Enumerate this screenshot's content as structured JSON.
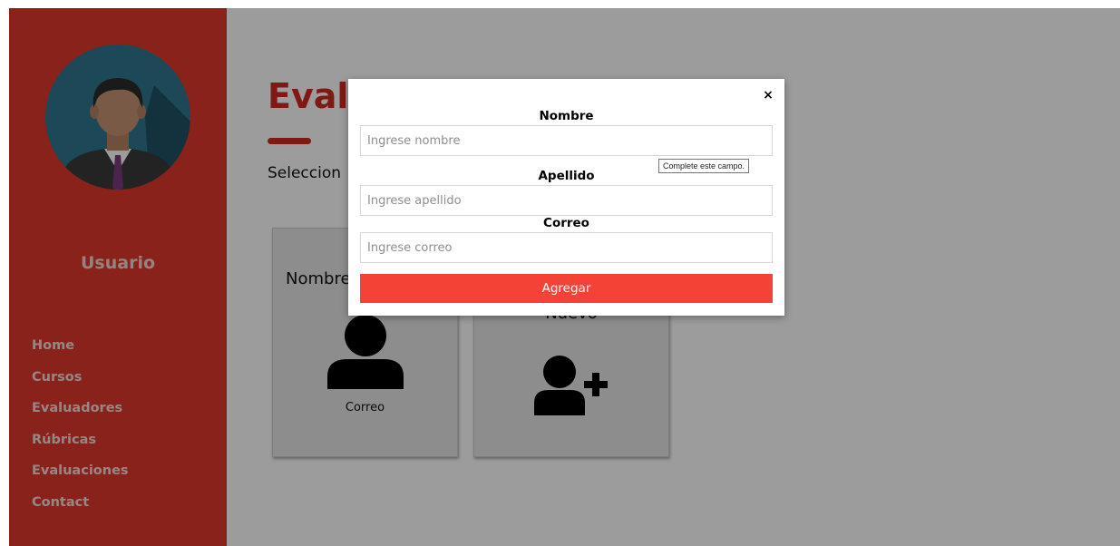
{
  "sidebar": {
    "user_name": "Usuario",
    "nav_items": [
      {
        "label": "Home",
        "name": "nav-home"
      },
      {
        "label": "Cursos",
        "name": "nav-cursos"
      },
      {
        "label": "Evaluadores",
        "name": "nav-evaluadores"
      },
      {
        "label": "Rúbricas",
        "name": "nav-rubricas"
      },
      {
        "label": "Evaluaciones",
        "name": "nav-evaluaciones"
      },
      {
        "label": "Contact",
        "name": "nav-contact"
      }
    ]
  },
  "main": {
    "title": "Evalu",
    "subtitle": "Seleccion",
    "cards": {
      "evaluator": {
        "name": "Nombre",
        "email": "Correo",
        "icon": "user-icon"
      },
      "new": {
        "title": "Nuevo",
        "icon": "user-plus-icon"
      }
    }
  },
  "modal": {
    "close_label": "×",
    "fields": {
      "nombre": {
        "label": "Nombre",
        "placeholder": "Ingrese nombre",
        "value": ""
      },
      "apellido": {
        "label": "Apellido",
        "placeholder": "Ingrese apellido",
        "value": ""
      },
      "correo": {
        "label": "Correo",
        "placeholder": "Ingrese correo",
        "value": ""
      }
    },
    "submit_label": "Agregar",
    "tooltip": "Complete este campo."
  },
  "colors": {
    "sidebar_bg": "#e0392c",
    "accent": "#d0291f",
    "button_bg": "#f44336",
    "overlay": "rgba(0,0,0,0.39)"
  }
}
